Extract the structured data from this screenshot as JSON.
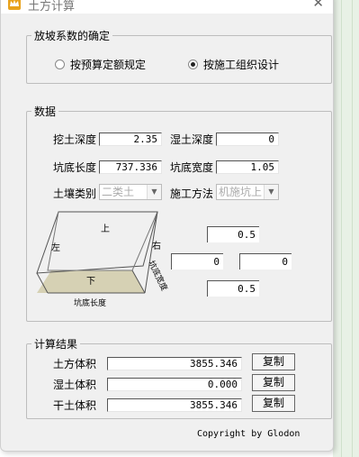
{
  "window": {
    "title": "土方计算",
    "close_glyph": "✕"
  },
  "slope": {
    "legend": "放坡系数的确定",
    "options": [
      {
        "label": "按预算定额规定",
        "selected": false
      },
      {
        "label": "按施工组织设计",
        "selected": true
      }
    ]
  },
  "data": {
    "legend": "数据",
    "dig_depth_label": "挖土深度",
    "dig_depth_value": "2.35",
    "wet_depth_label": "湿土深度",
    "wet_depth_value": "0",
    "pit_length_label": "坑底长度",
    "pit_length_value": "737.336",
    "pit_width_label": "坑底宽度",
    "pit_width_value": "1.05",
    "soil_type_label": "土壤类别",
    "soil_type_value": "二类土",
    "method_label": "施工方法",
    "method_value": "机施坑上",
    "diagram": {
      "top": "上",
      "left": "左",
      "right": "右",
      "bottom": "下",
      "length": "坑底长度",
      "width": "坑底宽度"
    },
    "slopes": {
      "top": "0.5",
      "left": "0",
      "right": "0",
      "bottom": "0.5"
    }
  },
  "results": {
    "legend": "计算结果",
    "earth_label": "土方体积",
    "earth_value": "3855.346",
    "wet_label": "湿土体积",
    "wet_value": "0.000",
    "dry_label": "干土体积",
    "dry_value": "3855.346",
    "copy_label": "复制"
  },
  "footer": "Copyright by Glodon"
}
